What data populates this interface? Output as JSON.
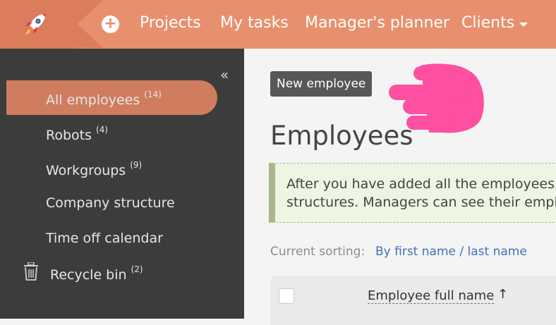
{
  "topbar": {
    "logo_icon": "rocket-icon",
    "add_icon": "plus-circle-icon",
    "nav": [
      {
        "label": "Projects"
      },
      {
        "label": "My tasks"
      },
      {
        "label": "Manager's planner"
      },
      {
        "label": "Clients"
      }
    ],
    "colors": {
      "bar": "#e8906e",
      "logo_bg": "#db7c5c"
    }
  },
  "sidebar": {
    "collapse_icon": "double-chevron-left-icon",
    "items": [
      {
        "label": "All employees",
        "count": "(14)",
        "active": true
      },
      {
        "label": "Robots",
        "count": "(4)"
      },
      {
        "label": "Workgroups",
        "count": "(9)"
      },
      {
        "label": "Company structure",
        "count": ""
      },
      {
        "label": "Time off calendar",
        "count": ""
      },
      {
        "label": "Recycle bin",
        "count": "(2)",
        "icon": "trash-icon"
      }
    ],
    "colors": {
      "bg": "#3c3c3c",
      "active": "#cf7d5e"
    }
  },
  "main": {
    "new_button": "New employee",
    "pointer_icon": "pointing-hand-icon",
    "title": "Employees",
    "info_lines": [
      "After you have added all the employees,",
      "structures. Managers can see their empl"
    ],
    "sorting_label": "Current sorting:",
    "sorting_value": "By first name / last name",
    "table": {
      "column_name": "Employee full name",
      "sort_indicator": "↑"
    }
  }
}
